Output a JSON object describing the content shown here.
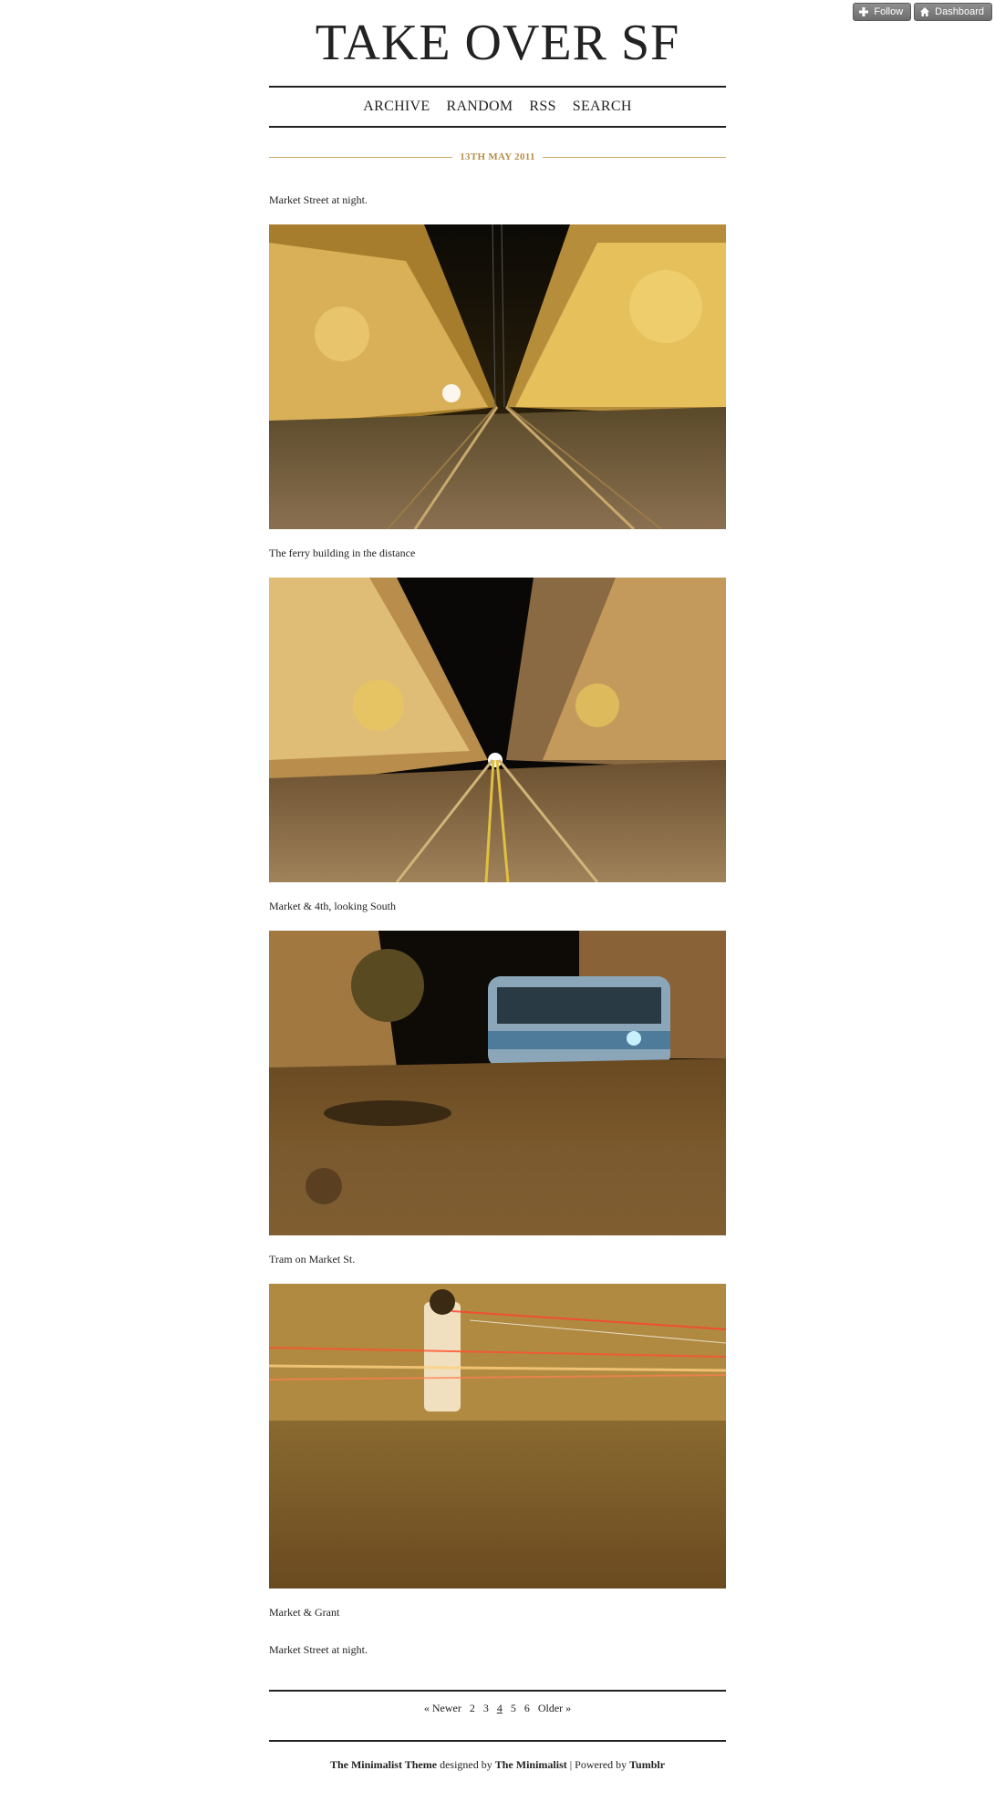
{
  "tumblr_controls": {
    "follow_label": "Follow",
    "dashboard_label": "Dashboard"
  },
  "site": {
    "title": "TAKE OVER SF"
  },
  "nav": {
    "items": [
      "ARCHIVE",
      "RANDOM",
      "RSS",
      "SEARCH"
    ]
  },
  "post": {
    "date": "13TH MAY 2011",
    "intro": "Market Street at night.",
    "photos": [
      {
        "caption": "The ferry building in the distance"
      },
      {
        "caption": "Market & 4th, looking South"
      },
      {
        "caption": "Tram on Market St."
      },
      {
        "caption": "Market & Grant"
      }
    ],
    "outro": "Market Street at night."
  },
  "pagination": {
    "newer": "« Newer",
    "pages": [
      "2",
      "3",
      "4",
      "5",
      "6"
    ],
    "current": "4",
    "older": "Older »"
  },
  "footer": {
    "theme": "The Minimalist Theme",
    "designed_by": "designed by",
    "designer": "The Minimalist",
    "separator": "| Powered by",
    "platform": "Tumblr"
  }
}
